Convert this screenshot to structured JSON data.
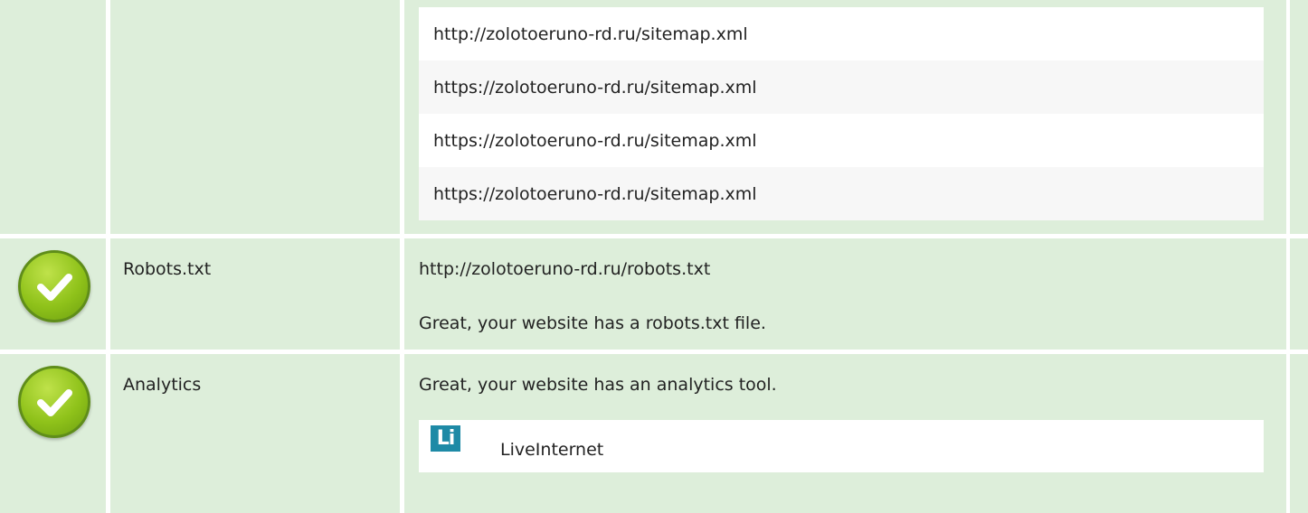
{
  "sitemaps": {
    "items": [
      "http://zolotoeruno-rd.ru/sitemap.xml",
      "https://zolotoeruno-rd.ru/sitemap.xml",
      "https://zolotoeruno-rd.ru/sitemap.xml",
      "https://zolotoeruno-rd.ru/sitemap.xml"
    ]
  },
  "robots": {
    "status_icon": "check-circle-icon",
    "label": "Robots.txt",
    "url": "http://zolotoeruno-rd.ru/robots.txt",
    "message": "Great, your website has a robots.txt file."
  },
  "analytics": {
    "status_icon": "check-circle-icon",
    "label": "Analytics",
    "message": "Great, your website has an analytics tool.",
    "tools": [
      {
        "icon_text": "Li",
        "name": "LiveInternet"
      }
    ]
  },
  "colors": {
    "row_background": "#ddeeda",
    "check_green": "#8fc21a",
    "liveinternet_blue": "#1e8aa6"
  }
}
